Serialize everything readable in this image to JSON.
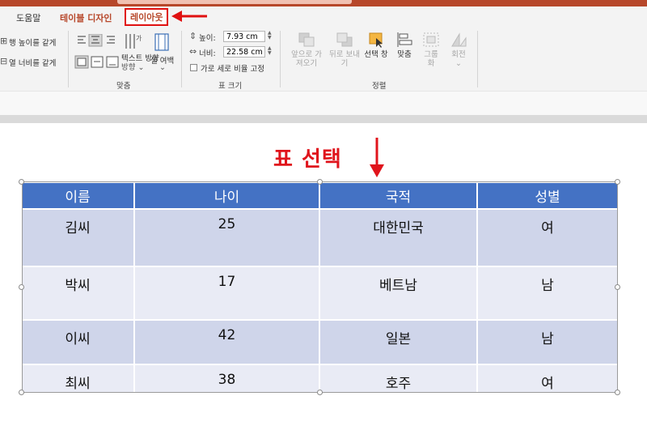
{
  "ribbon_tabs": [
    {
      "label": "도움말"
    },
    {
      "label": "테이블 디자인"
    },
    {
      "label": "레이아웃"
    }
  ],
  "ribbon": {
    "cell_size": {
      "row_height_label": "행 높이를 같게",
      "col_width_label": "열 너비를 같게"
    },
    "alignment": {
      "text_direction_label": "텍스트 방향",
      "cell_margin_label": "셀 여백",
      "group_name": "맞춤"
    },
    "table_size": {
      "height_label": "높이:",
      "height_value": "7.93 cm",
      "width_label": "너비:",
      "width_value": "22.58 cm",
      "lock_ratio_label": "가로 세로 비율 고정",
      "group_name": "표 크기"
    },
    "arrange": {
      "bring_forward_label": "앞으로 가져오기",
      "send_backward_label": "뒤로 보내기",
      "selection_pane_label": "선택 창",
      "align_label": "맞춤",
      "group_label": "그룹화",
      "rotate_label": "회전",
      "group_name": "정렬"
    }
  },
  "annotation": {
    "caption": "표 선택",
    "accent_color": "#e0141c"
  },
  "table": {
    "header_color": "#4472c4",
    "headers": [
      "이름",
      "나이",
      "국적",
      "성별"
    ],
    "rows": [
      [
        "김씨",
        "25",
        "대한민국",
        "여"
      ],
      [
        "박씨",
        "17",
        "베트남",
        "남"
      ],
      [
        "이씨",
        "42",
        "일본",
        "남"
      ],
      [
        "최씨",
        "38",
        "호주",
        "여"
      ]
    ]
  }
}
